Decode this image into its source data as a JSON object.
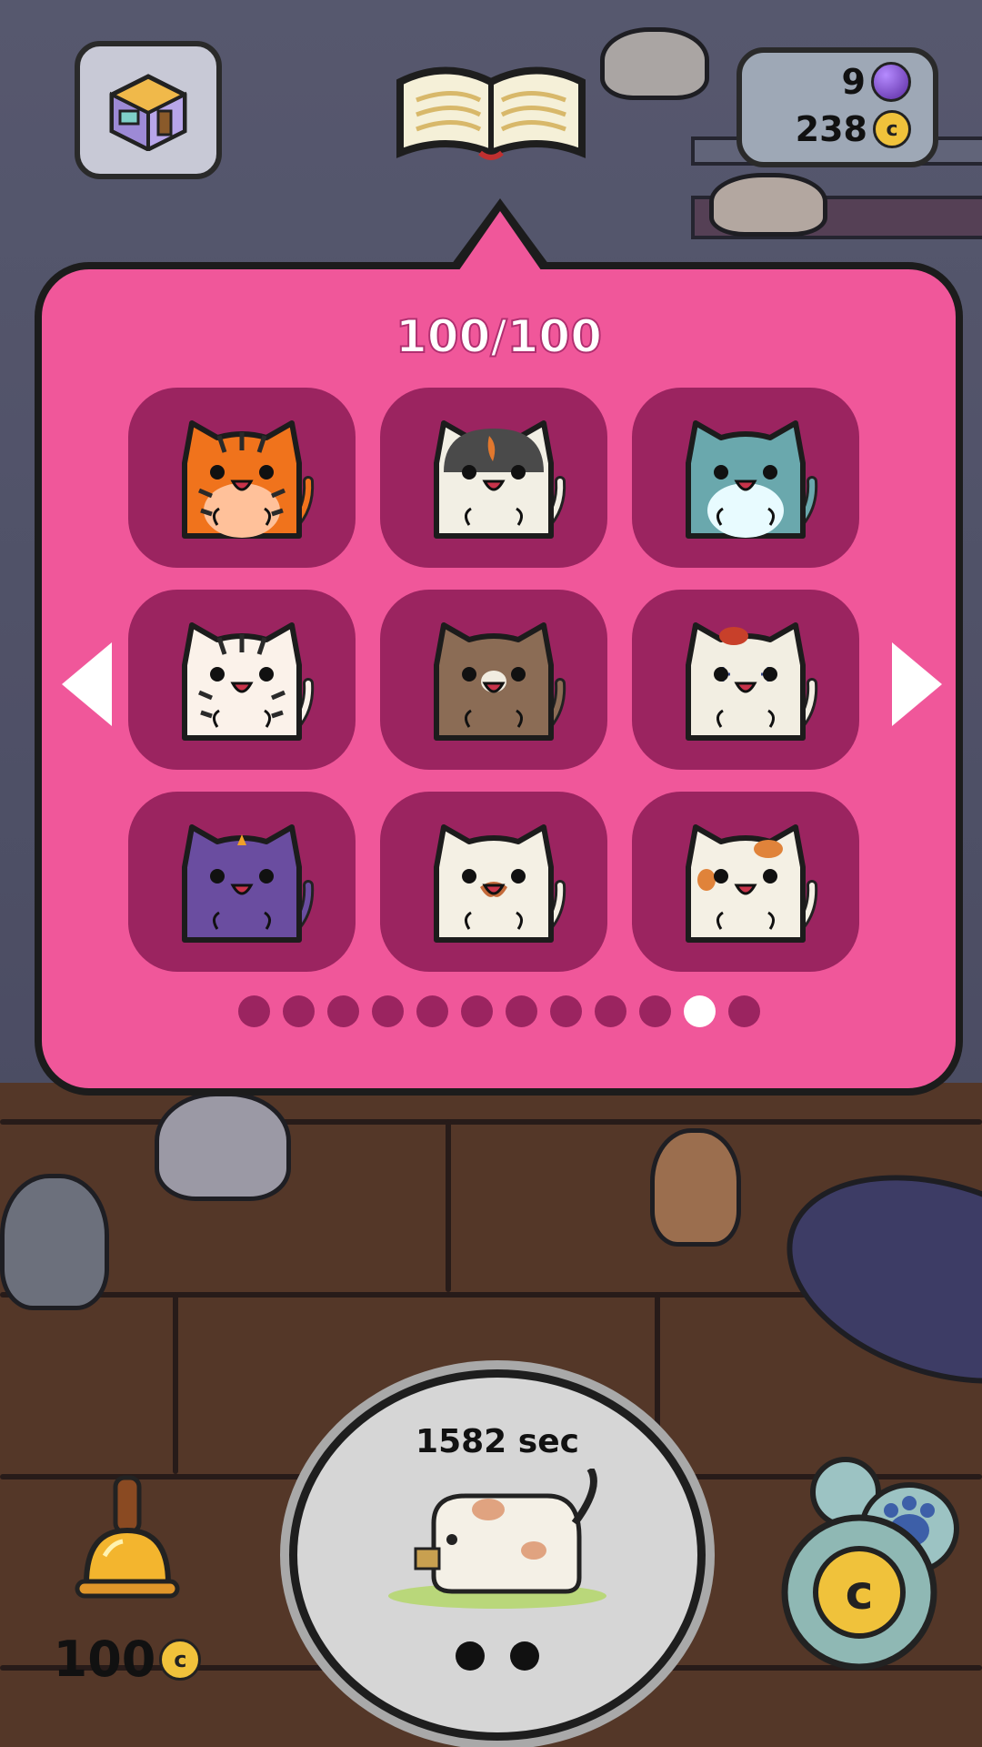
{
  "hud": {
    "gems": "9",
    "coins": "238",
    "room_icon": "room-cube-icon",
    "book_icon": "cat-book-icon"
  },
  "popup": {
    "title": "100/100",
    "page_count": 12,
    "active_page": 10,
    "cats": [
      {
        "name": "tiger-cat",
        "body": "#f0731c",
        "belly": "#ffc19a",
        "stripes": true
      },
      {
        "name": "black-white-cat",
        "body": "#f2efe4",
        "head": "#4a4a4a",
        "patch": "#e2782e"
      },
      {
        "name": "teal-cat",
        "body": "#6aa8ad",
        "belly": "#e8fbff"
      },
      {
        "name": "tabby-white-cat",
        "body": "#fbf2ea",
        "stripes": true
      },
      {
        "name": "brown-cat",
        "body": "#8b6c55",
        "muzzle": "#f1ece0"
      },
      {
        "name": "clown-cat",
        "body": "#f2eee2",
        "accent": "#c8402a"
      },
      {
        "name": "purple-cat",
        "body": "#6a4da0",
        "accent": "#f0a028"
      },
      {
        "name": "mustache-cat",
        "body": "#f4f0e4",
        "accent": "#c46a3a"
      },
      {
        "name": "calico-cat",
        "body": "#f4f0e4",
        "accent": "#e0833a"
      }
    ]
  },
  "bottom": {
    "bell_price": "100",
    "timer": "1582 sec",
    "coin_button_icon": "paw-coin-icon"
  },
  "colors": {
    "popup": "#f0579a",
    "tile": "#9b2460"
  }
}
